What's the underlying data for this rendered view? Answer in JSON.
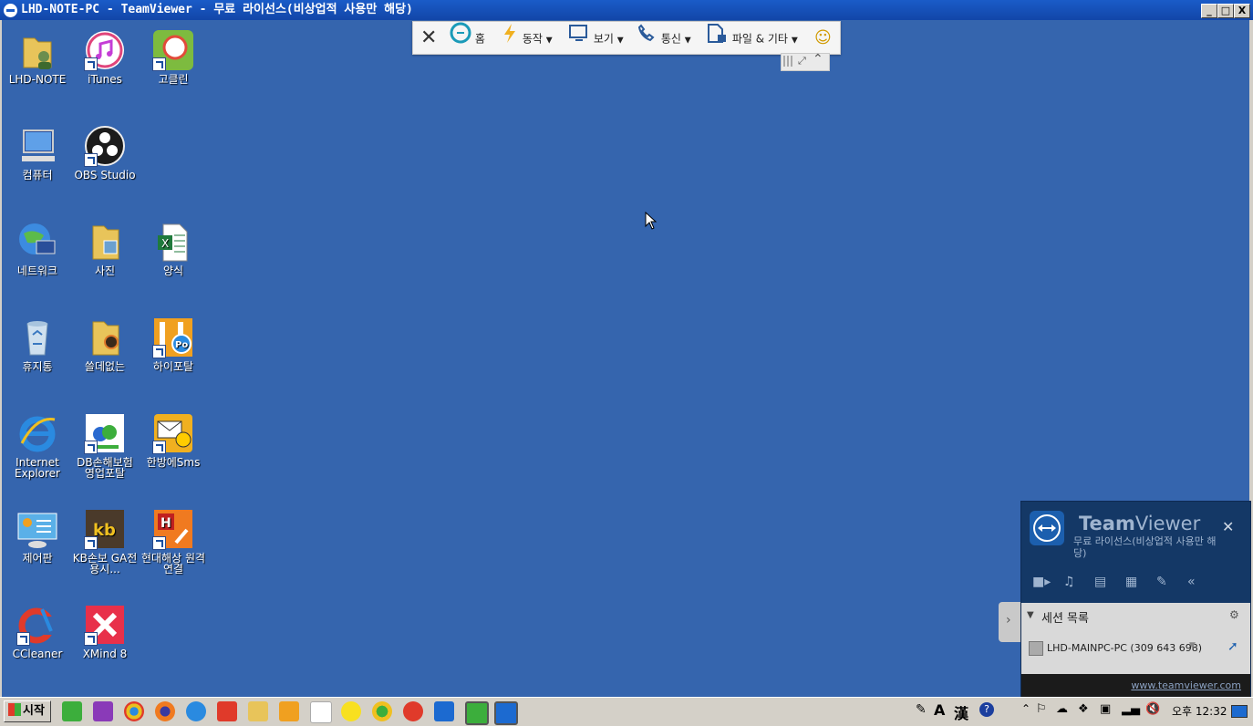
{
  "window": {
    "title": "LHD-NOTE-PC - TeamViewer - 무료 라이선스(비상업적 사용만 해당)",
    "min": "_",
    "max": "□",
    "close": "X"
  },
  "desktop": {
    "icons": [
      {
        "label": "LHD-NOTE",
        "icon": "user-folder-icon"
      },
      {
        "label": "iTunes",
        "icon": "itunes-icon"
      },
      {
        "label": "고클린",
        "icon": "goclean-icon"
      },
      {
        "label": "컴퓨터",
        "icon": "computer-icon"
      },
      {
        "label": "OBS Studio",
        "icon": "obs-icon"
      },
      {
        "label": "네트워크",
        "icon": "network-icon"
      },
      {
        "label": "사진",
        "icon": "photos-folder-icon"
      },
      {
        "label": "양식",
        "icon": "excel-icon"
      },
      {
        "label": "휴지통",
        "icon": "recycle-bin-icon"
      },
      {
        "label": "쓸데없는",
        "icon": "folder-icon"
      },
      {
        "label": "하이포탈",
        "icon": "hiportal-icon"
      },
      {
        "label": "Internet Explorer",
        "icon": "ie-icon"
      },
      {
        "label": "DB손해보험 영업포탈",
        "icon": "db-insurance-icon"
      },
      {
        "label": "한방에Sms",
        "icon": "sms-icon"
      },
      {
        "label": "제어판",
        "icon": "control-panel-icon"
      },
      {
        "label": "KB손보 GA전용시...",
        "icon": "kb-icon"
      },
      {
        "label": "현대해상 원격연결",
        "icon": "hyundai-icon"
      },
      {
        "label": "CCleaner",
        "icon": "ccleaner-icon"
      },
      {
        "label": "XMind 8",
        "icon": "xmind-icon"
      }
    ]
  },
  "toolbar": {
    "close": "✕",
    "home": "홈",
    "actions": "동작",
    "view": "보기",
    "communicate": "통신",
    "files": "파일 & 기타",
    "emoji": "☺"
  },
  "tvpanel": {
    "brand_bold": "Team",
    "brand_light": "Viewer",
    "license": "무료 라이선스(비상업적 사용만 해당)",
    "close": "✕",
    "session_header": "세션 목록",
    "session_item": "LHD-MAINPC-PC (309 643 698)",
    "link": "www.teamviewer.com"
  },
  "taskbar": {
    "start": "시작",
    "ime_a": "A",
    "ime_han": "漢",
    "clock": "오후 12:32"
  },
  "colors": {
    "desktop": "#3565ae",
    "titlebar": "#1a5cc8",
    "tv_panel": "#143866"
  }
}
